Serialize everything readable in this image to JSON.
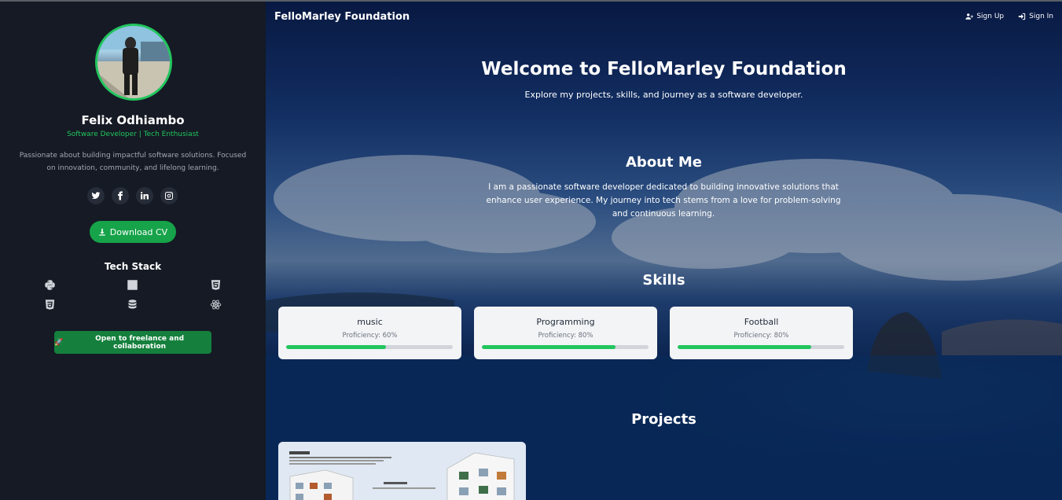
{
  "sidebar": {
    "name": "Felix Odhiambo",
    "role": "Software Developer | Tech Enthusiast",
    "bio": "Passionate about building impactful software solutions. Focused on innovation, community, and lifelong learning.",
    "socials": [
      "twitter-icon",
      "facebook-icon",
      "linkedin-icon",
      "instagram-icon"
    ],
    "download_label": "Download CV",
    "tech_stack_title": "Tech Stack",
    "tech_icons": [
      "python-icon",
      "javascript-icon",
      "html5-icon",
      "css3-icon",
      "database-icon",
      "react-icon"
    ],
    "freelance_label": "Open to freelance and collaboration",
    "freelance_emoji": "🚀"
  },
  "nav": {
    "brand": "FelloMarley Foundation",
    "signup_label": "Sign Up",
    "signin_label": "Sign In"
  },
  "hero": {
    "title": "Welcome to FelloMarley Foundation",
    "subtitle": "Explore my projects, skills, and journey as a software developer."
  },
  "about": {
    "title": "About Me",
    "text": "I am a passionate software developer dedicated to building innovative solutions that enhance user experience. My journey into tech stems from a love for problem-solving and continuous learning."
  },
  "skills": {
    "title": "Skills",
    "items": [
      {
        "name": "music",
        "proficiency_label": "Proficiency: 60%",
        "proficiency": 60
      },
      {
        "name": "Programming",
        "proficiency_label": "Proficiency: 80%",
        "proficiency": 80
      },
      {
        "name": "Football",
        "proficiency_label": "Proficiency: 80%",
        "proficiency": 80
      }
    ]
  },
  "projects": {
    "title": "Projects"
  },
  "colors": {
    "accent": "#22c55e",
    "sidebar_bg": "#151a24"
  }
}
